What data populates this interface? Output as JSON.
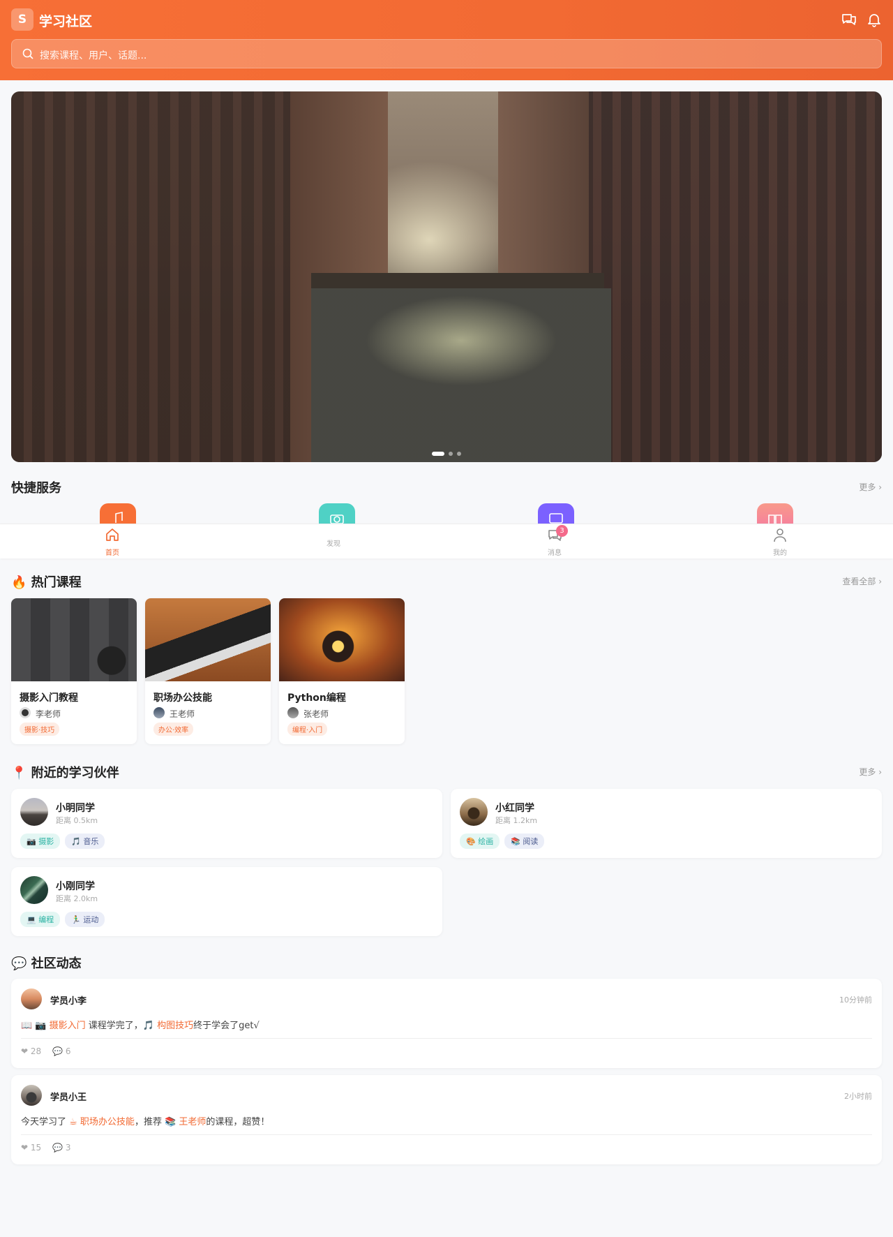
{
  "header": {
    "logo_letter": "S",
    "title": "学习社区",
    "search_placeholder": "搜索课程、用户、话题..."
  },
  "banner": {
    "slides": 3,
    "active_slide": 1
  },
  "quick_services": {
    "title": "快捷服务",
    "more": "更多 ›",
    "items": [
      {
        "icon": "music-icon",
        "color": "#f76f36"
      },
      {
        "icon": "camera-icon",
        "color": "#4fd1c5"
      },
      {
        "icon": "chat-icon",
        "color": "#7b61ff"
      },
      {
        "icon": "book-icon",
        "color": "#f88a9a"
      }
    ]
  },
  "tabbar": {
    "tabs": [
      {
        "label": "首页",
        "icon": "home-icon",
        "active": true
      },
      {
        "label": "发现",
        "icon": "compass-icon",
        "active": false
      },
      {
        "label": "消息",
        "icon": "message-icon",
        "active": false,
        "badge": "3"
      },
      {
        "label": "我的",
        "icon": "user-icon",
        "active": false
      }
    ]
  },
  "courses": {
    "title": "🔥 热门课程",
    "more": "查看全部 ›",
    "items": [
      {
        "title": "摄影入门教程",
        "author": "李老师",
        "tag": "摄影·技巧"
      },
      {
        "title": "职场办公技能",
        "author": "王老师",
        "tag": "办公·效率"
      },
      {
        "title": "Python编程",
        "author": "张老师",
        "tag": "编程·入门"
      }
    ]
  },
  "nearby": {
    "title": "📍 附近的学习伙伴",
    "more": "更多 ›",
    "users": [
      {
        "name": "小明同学",
        "distance": "距离 0.5km",
        "tags": [
          "📷 摄影",
          "🎵 音乐"
        ]
      },
      {
        "name": "小红同学",
        "distance": "距离 1.2km",
        "tags": [
          "🎨 绘画",
          "📚 阅读"
        ]
      },
      {
        "name": "小刚同学",
        "distance": "距离 2.0km",
        "tags": [
          "💻 编程",
          "🏃‍♂️ 运动"
        ]
      }
    ]
  },
  "posts": {
    "title": "💬 社区动态",
    "items": [
      {
        "name": "学员小李",
        "time": "10分钟前",
        "prefix": "📖 ",
        "hl1": "📷 摄影入门",
        "mid": " 课程学完了，",
        "hl2": "🎵 构图技巧",
        "suffix": "终于学会了get√",
        "likes": "❤ 28",
        "comments": "💬 6"
      },
      {
        "name": "学员小王",
        "time": "2小时前",
        "prefix": "今天学习了 ",
        "hl1": "☕ 职场办公技能",
        "mid": "，推荐 ",
        "hl2": "📚 王老师",
        "suffix": "的课程，超赞！",
        "likes": "❤ 15",
        "comments": "💬 3"
      }
    ]
  }
}
